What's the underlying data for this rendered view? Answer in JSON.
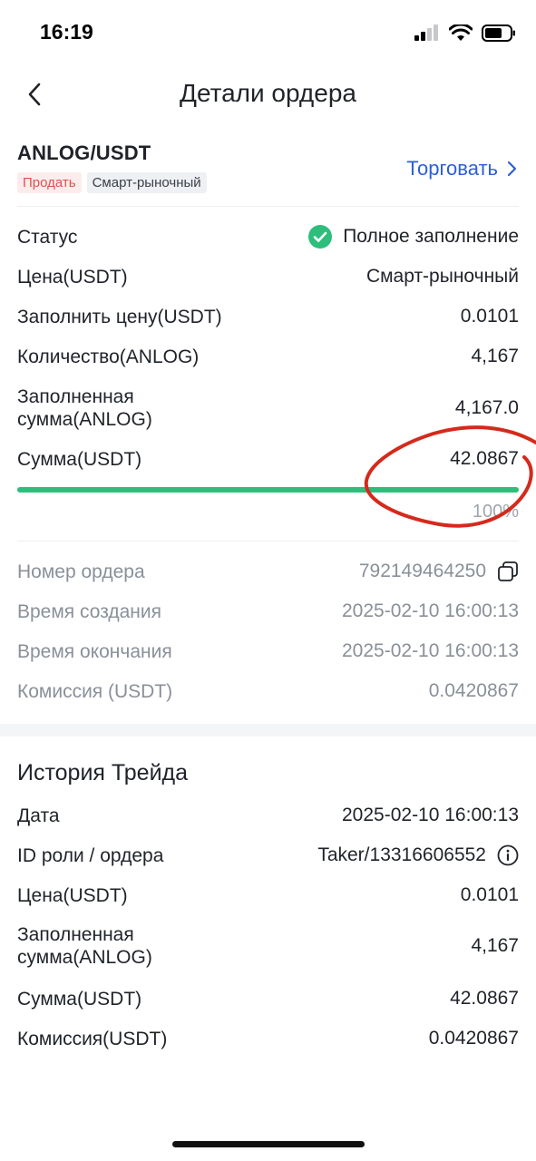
{
  "status_bar": {
    "time": "16:19"
  },
  "nav": {
    "title": "Детали ордера"
  },
  "pair": {
    "name": "ANLOG/USDT",
    "side_tag": "Продать",
    "type_tag": "Смарт-рыночный",
    "trade_label": "Торговать"
  },
  "order": {
    "status_label": "Статус",
    "status_value": "Полное заполнение",
    "price_label": "Цена(USDT)",
    "price_value": "Смарт-рыночный",
    "fill_price_label": "Заполнить цену(USDT)",
    "fill_price_value": "0.0101",
    "qty_label": "Количество(ANLOG)",
    "qty_value": "4,167",
    "filled_label": "Заполненная сумма(ANLOG)",
    "filled_value": "4,167.0",
    "amount_label": "Сумма(USDT)",
    "amount_value": "42.0867",
    "progress_percent": 100,
    "progress_text": "100%"
  },
  "meta": {
    "order_no_label": "Номер ордера",
    "order_no_value": "792149464250",
    "created_label": "Время создания",
    "created_value": "2025-02-10 16:00:13",
    "ended_label": "Время окончания",
    "ended_value": "2025-02-10 16:00:13",
    "fee_label": "Комиссия (USDT)",
    "fee_value": "0.0420867"
  },
  "history": {
    "title": "История Трейда",
    "date_label": "Дата",
    "date_value": "2025-02-10 16:00:13",
    "role_label": "ID роли / ордера",
    "role_value": "Taker/13316606552",
    "price_label": "Цена(USDT)",
    "price_value": "0.0101",
    "filled_label": "Заполненная сумма(ANLOG)",
    "filled_value": "4,167",
    "amount_label": "Сумма(USDT)",
    "amount_value": "42.0867",
    "fee_label": "Комиссия(USDT)",
    "fee_value": "0.0420867"
  },
  "colors": {
    "accent": "#2d5fd7",
    "success": "#2dbe7c",
    "sell": "#e0504f",
    "annotation": "#d42a1c"
  },
  "icons": [
    "back-chevron-icon",
    "chevron-right-icon",
    "check-circle-icon",
    "copy-icon",
    "info-icon",
    "signal-icon",
    "wifi-icon",
    "battery-icon"
  ]
}
